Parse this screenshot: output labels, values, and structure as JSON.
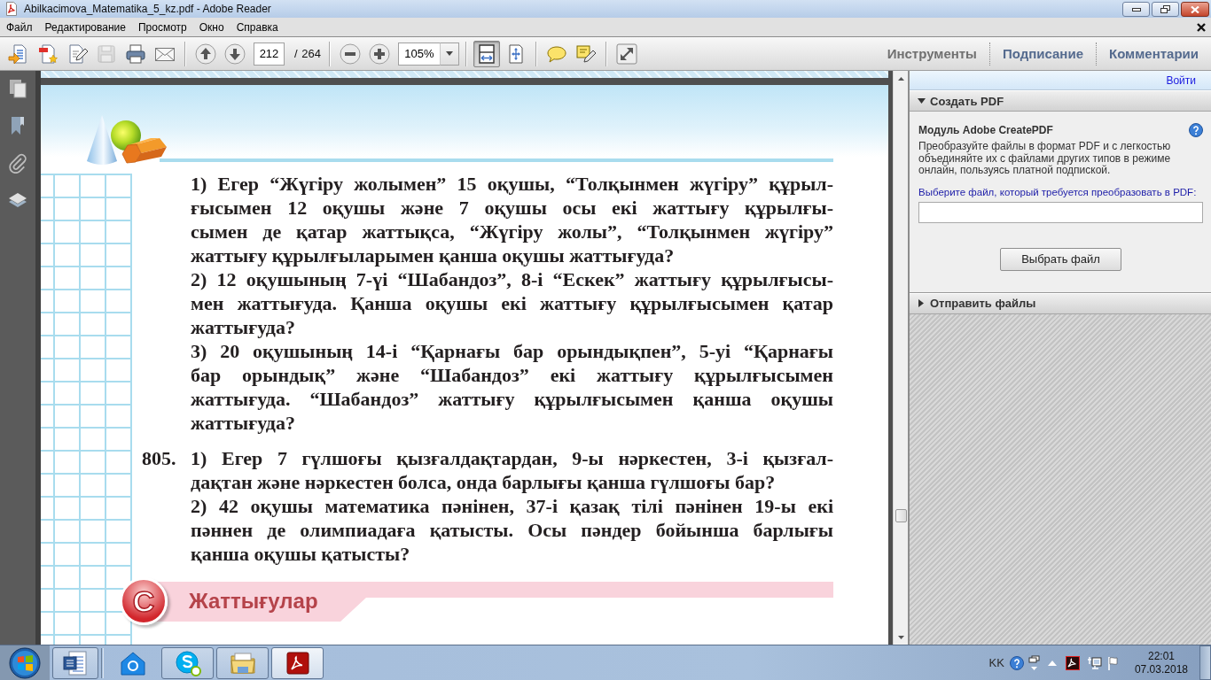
{
  "window": {
    "title": "Abilkacimova_Matematika_5_kz.pdf - Adobe Reader"
  },
  "menu": [
    "Файл",
    "Редактирование",
    "Просмотр",
    "Окно",
    "Справка"
  ],
  "toolbar": {
    "tools": [
      {
        "kind": "create",
        "disabled": false
      },
      {
        "kind": "export",
        "disabled": false
      },
      {
        "kind": "edit",
        "disabled": false
      },
      {
        "kind": "save",
        "disabled": true
      },
      {
        "kind": "print",
        "disabled": false
      },
      {
        "kind": "email",
        "disabled": false
      }
    ],
    "page_number": "212",
    "page_count": "/ 264",
    "zoom": "105%",
    "view_buttons": [
      {
        "kind": "fit-width",
        "selected": true
      },
      {
        "kind": "fit-page",
        "selected": false
      }
    ],
    "panes": [
      {
        "label": "Инструменты",
        "dimmed": true
      },
      {
        "label": "Подписание",
        "dimmed": false
      },
      {
        "label": "Комментарии",
        "dimmed": false
      }
    ]
  },
  "document": {
    "continued_items": [
      "1) Егер “Жүгіру жолымен” 15 оқушы, “Толқынмен жүгіру” құрыл-\nғысымен 12 оқушы және 7 оқушы осы екі жаттығу құрылғы-\nсымен де қатар жаттықса, “Жүгіру жолы”, “Толқынмен жүгіру”\nжаттығу құрылғыларымен қанша оқушы жаттығуда?",
      "2) 12 оқушының 7-үі “Шабандоз”, 8-і “Ескек” жаттығу құрылғысы-\nмен жаттығуда. Қанша оқушы екі жаттығу құрылғысымен қатар\nжаттығуда?",
      "3) 20 оқушының 14-і “Қарнағы бар орындықпен”, 5-уі “Қарнағы\nбар орындық” және “Шабандоз” екі жаттығу құрылғысымен\nжаттығуда. “Шабандоз” жаттығу құрылғысымен қанша оқушы\nжаттығуда?"
    ],
    "exercises": [
      {
        "number": "805.",
        "items": [
          "1) Егер 7 гүлшоғы қызғалдақтардан, 9-ы нәркестен, 3-і қызғал-\nдақтан және нәркестен болса, онда барлығы қанша гүлшоғы бар?",
          "2) 42 оқушы математика пәнінен, 37-і қазақ тілі пәнінен 19-ы екі\nпәннен де олимпиадаға қатысты. Осы пәндер бойынша барлығы\nқанша оқушы қатысты?"
        ]
      }
    ],
    "section": {
      "badge": "С",
      "title": "Жаттығулар"
    }
  },
  "right_panel": {
    "sign_in": "Войти",
    "sections": [
      {
        "title": "Создать PDF",
        "expanded": true,
        "heading": "Модуль Adobe CreatePDF",
        "description": "Преобразуйте файлы в формат PDF и с легкостью объединяйте их с файлами других типов в режиме онлайн, пользуясь платной подпиской.",
        "field_label": "Выберите файл, который требуется преобразовать в PDF:",
        "button": "Выбрать файл"
      },
      {
        "title": "Отправить файлы",
        "expanded": false
      }
    ]
  },
  "taskbar": {
    "toolbar_apps": [
      {
        "kind": "word",
        "running": true,
        "selected": false
      }
    ],
    "apps": [
      {
        "kind": "mail",
        "running": false,
        "selected": false
      },
      {
        "kind": "skype",
        "running": true,
        "selected": false
      },
      {
        "kind": "explorer",
        "running": true,
        "selected": false
      },
      {
        "kind": "reader",
        "running": true,
        "selected": true
      }
    ],
    "language": "KK",
    "time": "22:01",
    "date": "07.03.2018"
  }
}
